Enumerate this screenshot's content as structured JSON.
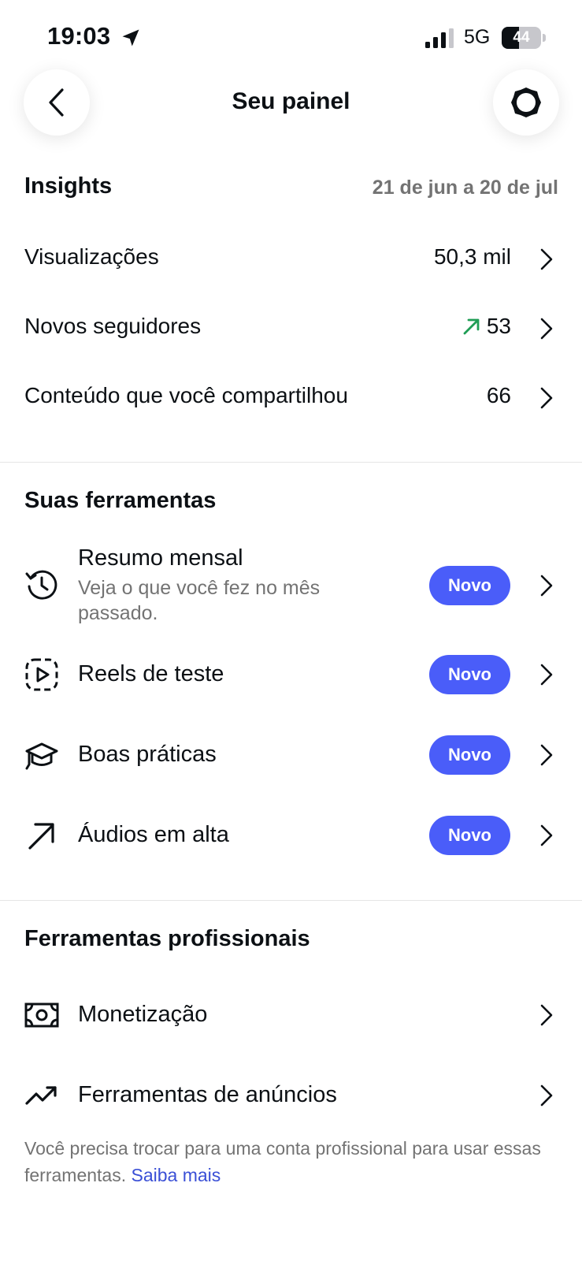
{
  "status_bar": {
    "time": "19:03",
    "network": "5G",
    "battery_percent": "44",
    "battery_level": 0.44
  },
  "header": {
    "title": "Seu painel",
    "back_icon": "chevron-left-icon",
    "settings_icon": "gear-icon"
  },
  "insights": {
    "title": "Insights",
    "date_range": "21 de jun a 20 de jul",
    "rows": [
      {
        "label": "Visualizações",
        "value": "50,3 mil"
      },
      {
        "label": "Novos seguidores",
        "value": "53",
        "trend": "up",
        "trend_color": "#1f9d55"
      },
      {
        "label": "Conteúdo que você compartilhou",
        "value": "66"
      }
    ]
  },
  "tools": {
    "title": "Suas ferramentas",
    "items": [
      {
        "label": "Resumo mensal",
        "subtitle": "Veja o que você fez no mês passado.",
        "badge": "Novo",
        "icon": "history-icon"
      },
      {
        "label": "Reels de teste",
        "badge": "Novo",
        "icon": "reel-play-icon"
      },
      {
        "label": "Boas práticas",
        "badge": "Novo",
        "icon": "graduation-cap-icon"
      },
      {
        "label": "Áudios em alta",
        "badge": "Novo",
        "icon": "arrow-up-right-icon"
      }
    ],
    "badge_color": "#4a5df9"
  },
  "pro_tools": {
    "title": "Ferramentas profissionais",
    "items": [
      {
        "label": "Monetização",
        "icon": "money-icon"
      },
      {
        "label": "Ferramentas de anúncios",
        "icon": "trending-up-icon"
      }
    ],
    "note": "Você precisa trocar para uma conta profissional para usar essas ferramentas.",
    "note_link": "Saiba mais",
    "link_color": "#3a4fd6"
  }
}
